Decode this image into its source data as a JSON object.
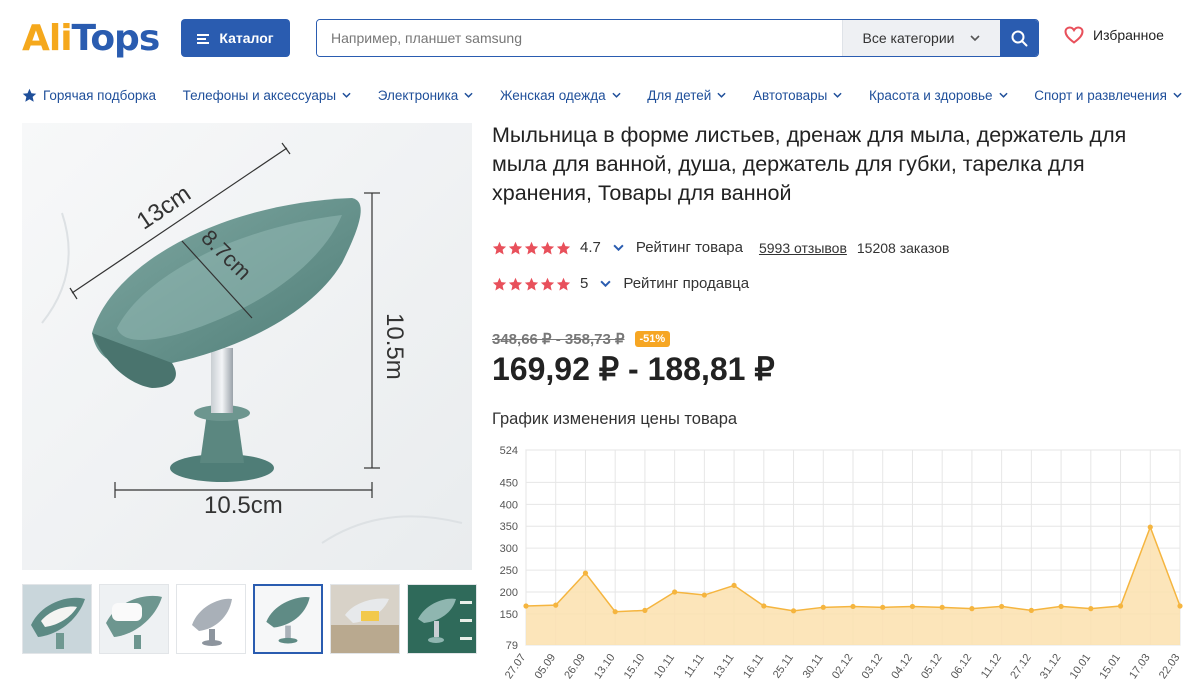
{
  "header": {
    "logo_part1": "Ali",
    "logo_part2": "Tops",
    "catalog_label": "Каталог",
    "search_placeholder": "Например, планшет samsung",
    "search_category": "Все категории",
    "favorites_label": "Избранное"
  },
  "nav": {
    "items": [
      {
        "label": "Горячая подборка"
      },
      {
        "label": "Телефоны и аксессуары"
      },
      {
        "label": "Электроника"
      },
      {
        "label": "Женская одежда"
      },
      {
        "label": "Для детей"
      },
      {
        "label": "Автотовары"
      },
      {
        "label": "Красота и здоровье"
      },
      {
        "label": "Спорт и развлечения"
      }
    ]
  },
  "image_labels": {
    "length": "13cm",
    "depth": "8.7cm",
    "height": "10.5m",
    "width": "10.5cm"
  },
  "product": {
    "title": "Мыльница в форме листьев, дренаж для мыла, держатель для мыла для ванной, душа, держатель для губки, тарелка для хранения, Товары для ванной",
    "rating_value": "4.7",
    "rating_label": "Рейтинг товара",
    "reviews": "5993 отзывов",
    "orders": "15208 заказов",
    "seller_rating_value": "5",
    "seller_rating_label": "Рейтинг продавца",
    "old_price": "348,66 ₽ - 358,73 ₽",
    "discount": "-51%",
    "price": "169,92 ₽ - 188,81 ₽",
    "chart_heading": "График изменения цены товара"
  },
  "colors": {
    "brand_blue": "#2a5cb0",
    "brand_orange": "#f5a81c",
    "star_red": "#e8505b",
    "chart_line": "#f5b53f",
    "chart_fill": "#fbe1ae"
  },
  "chart_data": {
    "type": "area",
    "title": "График изменения цены товара",
    "x": [
      "27.07",
      "05.09",
      "26.09",
      "13.10",
      "15.10",
      "10.11",
      "11.11",
      "13.11",
      "16.11",
      "25.11",
      "30.11",
      "02.12",
      "03.12",
      "04.12",
      "05.12",
      "06.12",
      "11.12",
      "27.12",
      "31.12",
      "10.01",
      "15.01",
      "17.03",
      "22.03"
    ],
    "values": [
      168,
      170,
      243,
      155,
      158,
      200,
      193,
      215,
      168,
      157,
      165,
      167,
      165,
      167,
      165,
      162,
      167,
      158,
      167,
      162,
      168,
      348,
      168
    ],
    "yticks": [
      79,
      150,
      200,
      250,
      300,
      350,
      400,
      450,
      524
    ],
    "ylim": [
      79,
      524
    ],
    "grid": true
  }
}
